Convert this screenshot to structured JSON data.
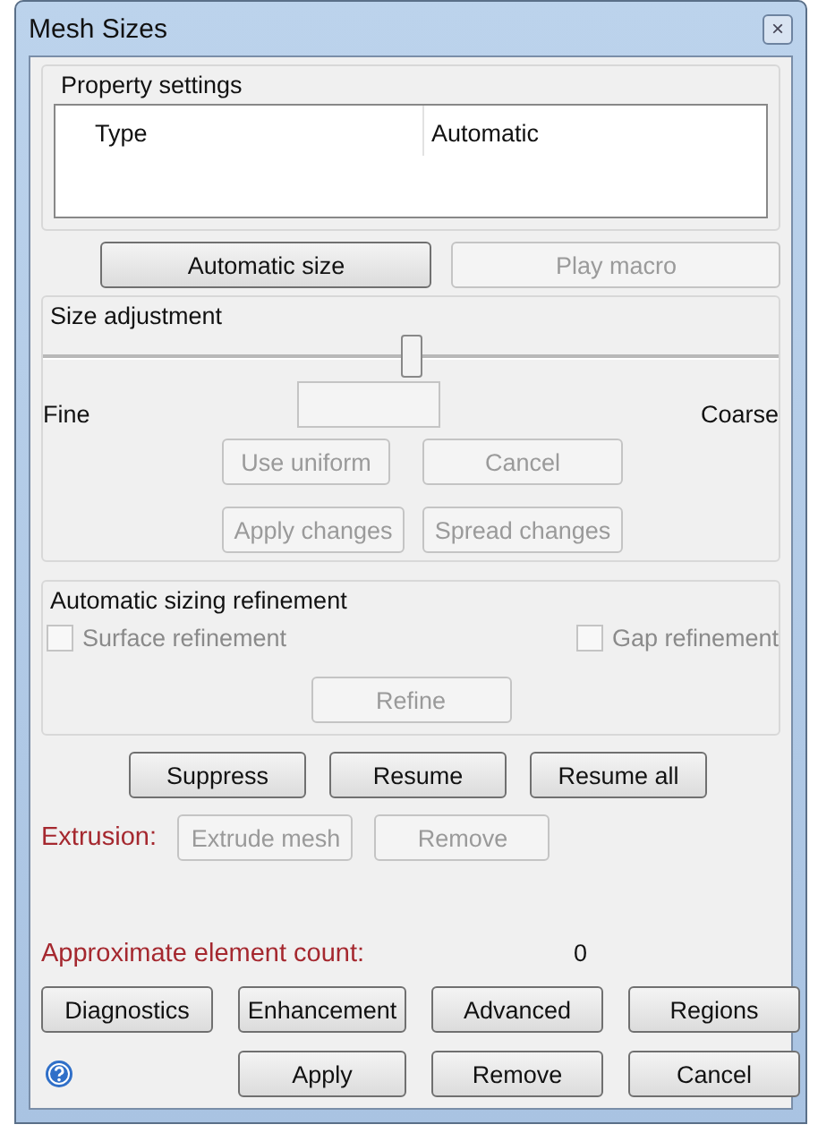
{
  "window": {
    "title": "Mesh Sizes",
    "close": "×"
  },
  "property_settings": {
    "title": "Property settings",
    "columns": [
      "Type",
      "Automatic"
    ]
  },
  "top_buttons": [
    {
      "label": "Automatic size",
      "disabled": false
    },
    {
      "label": "Play macro",
      "disabled": true
    }
  ],
  "size_adjustment": {
    "title": "Size adjustment",
    "level": 0.5,
    "fine": "Fine",
    "coarse": "Coarse",
    "buttons": [
      {
        "label": "Use uniform",
        "disabled": true
      },
      {
        "label": "Cancel",
        "disabled": true
      },
      {
        "label": "Apply changes",
        "disabled": true
      },
      {
        "label": "Spread changes",
        "disabled": true
      }
    ]
  },
  "refinement": {
    "title": "Automatic sizing refinement",
    "checkboxes": [
      {
        "label": "Surface refinement",
        "checked": false,
        "disabled": true
      },
      {
        "label": "Gap refinement",
        "checked": false,
        "disabled": true
      }
    ],
    "button": {
      "label": "Refine",
      "disabled": true
    }
  },
  "suppress_buttons": [
    {
      "label": "Suppress",
      "disabled": false
    },
    {
      "label": "Resume",
      "disabled": false
    },
    {
      "label": "Resume all",
      "disabled": false
    }
  ],
  "extrusion": {
    "label": "Extrusion:",
    "buttons": [
      {
        "label": "Extrude mesh",
        "disabled": true
      },
      {
        "label": "Remove",
        "disabled": true
      }
    ]
  },
  "element_count": {
    "label": "Approximate element count:",
    "value": "0"
  },
  "bottom_buttons": [
    {
      "label": "Diagnostics",
      "disabled": false
    },
    {
      "label": "Enhancement",
      "disabled": false
    },
    {
      "label": "Advanced",
      "disabled": false
    },
    {
      "label": "Regions",
      "disabled": false
    }
  ],
  "action_buttons": [
    {
      "label": "Apply",
      "disabled": false
    },
    {
      "label": "Remove",
      "disabled": false
    },
    {
      "label": "Cancel",
      "disabled": false
    }
  ]
}
